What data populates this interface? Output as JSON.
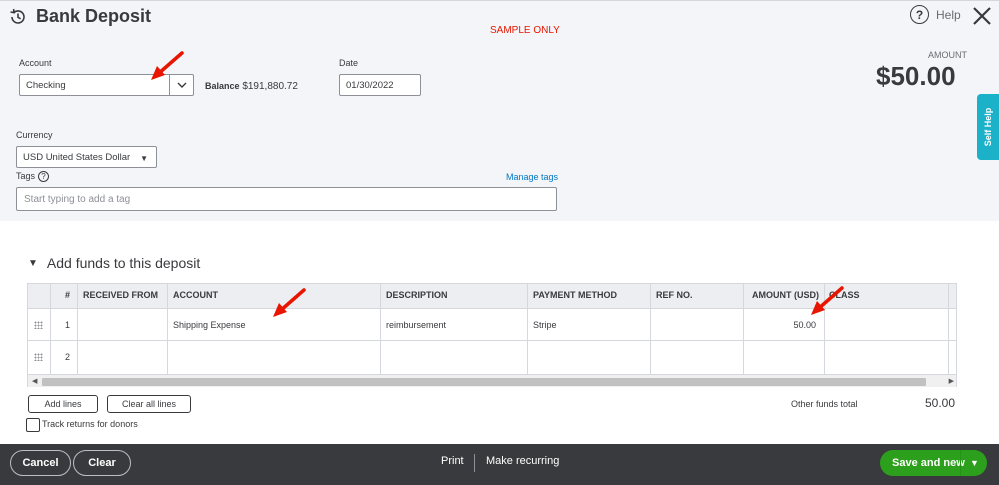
{
  "header": {
    "title": "Bank Deposit",
    "sample_notice": "SAMPLE ONLY",
    "help_label": "Help",
    "help_glyph": "?"
  },
  "form": {
    "account_label": "Account",
    "account_value": "Checking",
    "balance_label": "Balance",
    "balance_value": "$191,880.72",
    "date_label": "Date",
    "date_value": "01/30/2022",
    "amount_label": "AMOUNT",
    "amount_value": "$50.00",
    "currency_label": "Currency",
    "currency_value": "USD United States Dollar",
    "tags_label": "Tags",
    "tags_help_glyph": "?",
    "manage_tags": "Manage tags",
    "tags_placeholder": "Start typing to add a tag"
  },
  "self_help": "Self Help",
  "funds": {
    "section_title": "Add funds to this deposit",
    "columns": [
      "#",
      "RECEIVED FROM",
      "ACCOUNT",
      "DESCRIPTION",
      "PAYMENT METHOD",
      "REF NO.",
      "AMOUNT (USD)",
      "CLASS"
    ],
    "rows": [
      {
        "num": "1",
        "received_from": "",
        "account": "Shipping Expense",
        "description": "reimbursement",
        "payment_method": "Stripe",
        "ref_no": "",
        "amount": "50.00",
        "class": ""
      },
      {
        "num": "2",
        "received_from": "",
        "account": "",
        "description": "",
        "payment_method": "",
        "ref_no": "",
        "amount": "",
        "class": ""
      }
    ],
    "add_lines": "Add lines",
    "clear_all_lines": "Clear all lines",
    "other_total_label": "Other funds total",
    "other_total_value": "50.00",
    "track_returns_label": "Track returns for donors"
  },
  "footer": {
    "cancel": "Cancel",
    "clear": "Clear",
    "print": "Print",
    "make_recurring": "Make recurring",
    "save_and_new": "Save and new"
  },
  "colors": {
    "primary_green": "#2ca01c",
    "footer_bg": "#393a3d",
    "link_blue": "#0077c5",
    "self_help_teal": "#1ab1c9",
    "annotation_red": "#e81500"
  },
  "icons": [
    "history-icon",
    "help-circle-icon",
    "close-icon",
    "chevron-down-icon",
    "drag-handle-icon",
    "annotation-arrow-icon"
  ]
}
